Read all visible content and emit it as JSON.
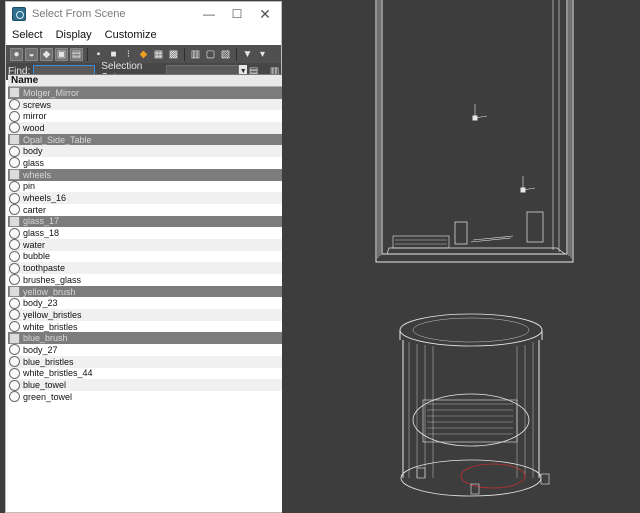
{
  "window": {
    "title": "Select From Scene",
    "minimize_glyph": "—",
    "maximize_glyph": "☐",
    "close_glyph": "✕"
  },
  "menu": [
    "Select",
    "Display",
    "Customize"
  ],
  "findbar": {
    "find_label": "Find:",
    "find_value": "",
    "selection_set_label": "Selection Set:",
    "selection_set_value": ""
  },
  "list": {
    "header": "Name",
    "items": [
      {
        "label": "Molger_Mirror",
        "group": true
      },
      {
        "label": "screws",
        "group": false
      },
      {
        "label": "mirror",
        "group": false
      },
      {
        "label": "wood",
        "group": false
      },
      {
        "label": "Opal_Side_Table",
        "group": true
      },
      {
        "label": "body",
        "group": false
      },
      {
        "label": "glass",
        "group": false
      },
      {
        "label": "wheels",
        "group": true
      },
      {
        "label": "pin",
        "group": false
      },
      {
        "label": "wheels_16",
        "group": false
      },
      {
        "label": "carter",
        "group": false
      },
      {
        "label": "glass_17",
        "group": true
      },
      {
        "label": "glass_18",
        "group": false
      },
      {
        "label": "water",
        "group": false
      },
      {
        "label": "bubble",
        "group": false
      },
      {
        "label": "toothpaste",
        "group": false
      },
      {
        "label": "brushes_glass",
        "group": false
      },
      {
        "label": "yellow_brush",
        "group": true
      },
      {
        "label": "body_23",
        "group": false
      },
      {
        "label": "yellow_bristles",
        "group": false
      },
      {
        "label": "white_bristles",
        "group": false
      },
      {
        "label": "blue_brush",
        "group": true
      },
      {
        "label": "body_27",
        "group": false
      },
      {
        "label": "blue_bristles",
        "group": false
      },
      {
        "label": "white_bristles_44",
        "group": false
      },
      {
        "label": "blue_towel",
        "group": false
      },
      {
        "label": "green_towel",
        "group": false
      }
    ]
  },
  "colors": {
    "viewport_bg": "#3d3d3d",
    "wire": "#e8e8e8",
    "group_row": "#7c7c7c",
    "toolbar_bg": "#505050",
    "find_focus": "#3c8fd6"
  }
}
